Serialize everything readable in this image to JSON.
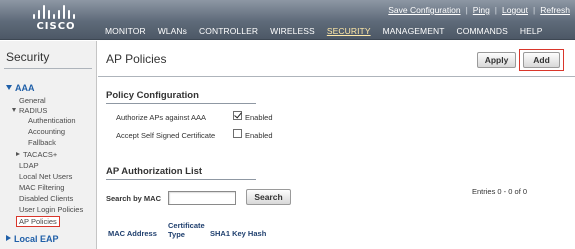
{
  "header": {
    "logo_text": "CISCO",
    "util_links": [
      "Save Configuration",
      "Ping",
      "Logout",
      "Refresh"
    ],
    "nav": [
      {
        "label": "MONITOR",
        "active": false
      },
      {
        "label": "WLANs",
        "active": false
      },
      {
        "label": "CONTROLLER",
        "active": false
      },
      {
        "label": "WIRELESS",
        "active": false
      },
      {
        "label": "SECURITY",
        "active": true
      },
      {
        "label": "MANAGEMENT",
        "active": false
      },
      {
        "label": "COMMANDS",
        "active": false
      },
      {
        "label": "HELP",
        "active": false
      }
    ]
  },
  "sidebar": {
    "title": "Security",
    "items": {
      "aaa": "AAA",
      "general": "General",
      "radius": "RADIUS",
      "authentication": "Authentication",
      "accounting": "Accounting",
      "fallback": "Fallback",
      "tacacs": "TACACS+",
      "ldap": "LDAP",
      "local_net_users": "Local Net Users",
      "mac_filtering": "MAC Filtering",
      "disabled_clients": "Disabled Clients",
      "user_login_policies": "User Login Policies",
      "ap_policies": "AP Policies",
      "local_eap": "Local EAP"
    }
  },
  "main": {
    "page_title": "AP Policies",
    "apply_label": "Apply",
    "add_label": "Add",
    "policy_config": {
      "heading": "Policy Configuration",
      "authorize_label": "Authorize APs against AAA",
      "authorize_checked": true,
      "authorize_value": "Enabled",
      "self_signed_label": "Accept Self Signed Certificate",
      "self_signed_checked": false,
      "self_signed_value": "Enabled"
    },
    "auth_list": {
      "heading": "AP Authorization List",
      "entries": "Entries 0 - 0 of 0",
      "search_label": "Search by MAC",
      "search_value": "",
      "search_button": "Search",
      "columns": {
        "mac": "MAC Address",
        "cert_1": "Certificate",
        "cert_2": "Type",
        "sha1": "SHA1 Key Hash"
      }
    }
  }
}
